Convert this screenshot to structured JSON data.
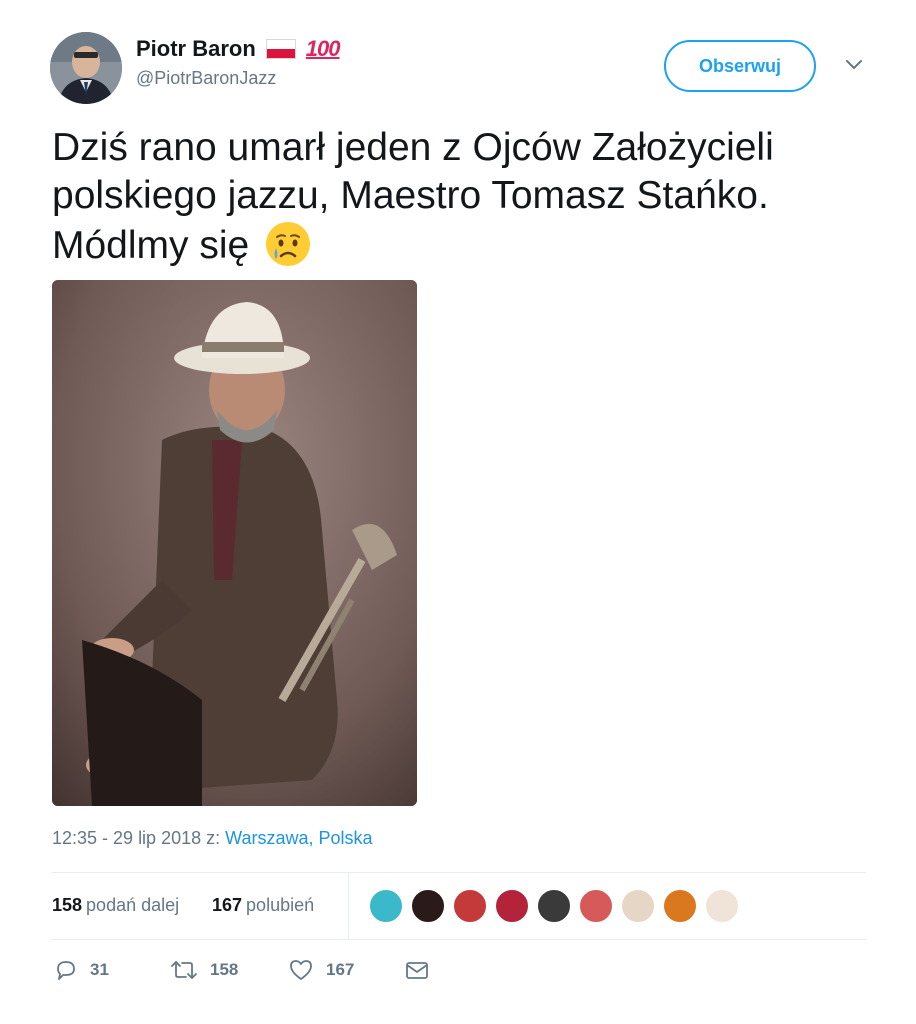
{
  "user": {
    "display_name": "Piotr Baron",
    "handle": "@PiotrBaronJazz",
    "avatar_icon": "profile-photo",
    "badges": [
      "poland-flag-icon",
      "hundred-points-icon"
    ]
  },
  "follow_button": {
    "label": "Obserwuj"
  },
  "menu": {
    "icon": "chevron-down-icon"
  },
  "tweet": {
    "lines": [
      "Dziś rano umarł jeden z Ojców Założycieli",
      "polskiego jazzu, Maestro Tomasz Stańko.",
      "Módlmy się"
    ],
    "emoji": "crying-face-icon"
  },
  "meta": {
    "time_prefix": "12:35 - 29 lip 2018 z: ",
    "location": "Warszawa, Polska"
  },
  "stats": {
    "retweets_count": "158",
    "retweets_label": "podań dalej",
    "likes_count": "167",
    "likes_label": "polubień"
  },
  "actions": {
    "reply_count": "31",
    "retweet_count": "158",
    "like_count": "167"
  },
  "colors": {
    "accent": "#1da1f2",
    "text": "#14171a",
    "muted": "#657786"
  }
}
